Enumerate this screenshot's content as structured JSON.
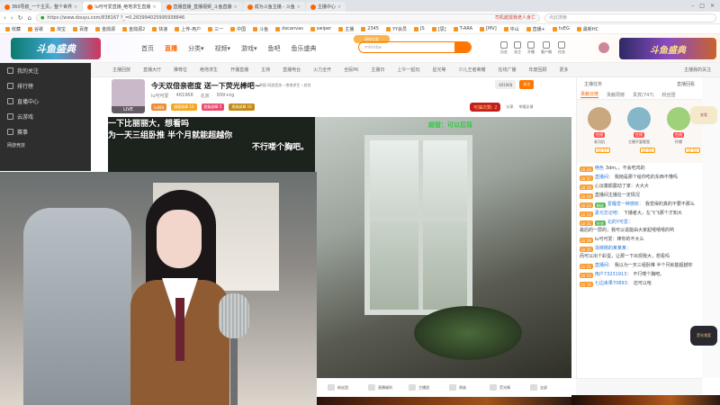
{
  "browser": {
    "tabs": [
      {
        "label": "360导航_一个主页，整个世界",
        "active": false
      },
      {
        "label": "lu可可爱直播_绝地求生直播",
        "active": true
      },
      {
        "label": "直播直播_直播视频_斗鱼直播",
        "active": false
      },
      {
        "label": "成为斗鱼主播 - 斗鱼",
        "active": false
      },
      {
        "label": "主播中心",
        "active": false
      }
    ],
    "url": "https://www.douyu.com/838167 ?_=0.263994025995938846",
    "url_hot": "司机越需我老人身亡",
    "search_placeholder": "点此搜索",
    "bookmarks": [
      "收藏",
      "谷歌",
      "淘宝",
      "百度",
      "金鼎源",
      "金鼎源2",
      "快速",
      "上传-用户",
      "三一",
      "中国",
      "斗鱼",
      "dxcanvas",
      "swiper",
      "主播",
      "2345",
      "YY会员",
      "JS",
      "[思]",
      "T-ARA",
      "[MV]",
      "中山",
      "直播+",
      "tvEG",
      "最新HC"
    ]
  },
  "header": {
    "logo_text": "斗鱼盛典",
    "nav": [
      {
        "label": "首页",
        "active": false
      },
      {
        "label": "直播",
        "active": true
      },
      {
        "label": "分类▾",
        "active": false
      },
      {
        "label": "视频▾",
        "active": false
      },
      {
        "label": "游戏▾",
        "active": false
      },
      {
        "label": "鱼吧",
        "active": false
      },
      {
        "label": "鱼乐盛典",
        "active": false
      }
    ],
    "promo_label": "接你出发",
    "search_placeholder": "mimiba",
    "icons": [
      {
        "name": "history",
        "label": "历史"
      },
      {
        "name": "follow",
        "label": "关注"
      },
      {
        "name": "live",
        "label": "开播"
      },
      {
        "name": "client",
        "label": "客户端"
      },
      {
        "name": "task",
        "label": "任务"
      }
    ],
    "banner_right": "斗鱼盛典"
  },
  "sidebar": {
    "items": [
      {
        "label": "我的关注"
      },
      {
        "label": "排行榜"
      },
      {
        "label": "直播中心"
      },
      {
        "label": "云游戏"
      },
      {
        "label": "赛事"
      }
    ],
    "small_item": "网游竞技"
  },
  "catbar": {
    "items": [
      "主播回放",
      "直播大厅",
      "推荐位",
      "绝地求生",
      "开播直播",
      "主持",
      "直播电台",
      "火力全开",
      "全民PK",
      "主播日",
      "上午一起玩",
      "星光等",
      "少儿王者荣耀",
      "在线广播",
      "年度回顾",
      "更多"
    ],
    "my_follow": "主播我的关注"
  },
  "room": {
    "title": "今天双倍亲密度 送一下荧光棒吧~",
    "title_meta": "举报  网游竞技 › 绝地求生 › 综合",
    "live_badge": "LIVE",
    "streamer": "lu可可爱",
    "room_id": "481968",
    "area": "北京",
    "followers": "999+kg",
    "tags": [
      {
        "label": "lv888",
        "color": "#f08d34"
      },
      {
        "label": "福星勋章 10",
        "color": "#f5a623"
      },
      {
        "label": "超级勋章 5",
        "color": "#e94b6f"
      },
      {
        "label": "贵族勋章 10",
        "color": "#c48b14"
      }
    ],
    "btn_id": "481968",
    "btn_follow": "关注",
    "hongbao": "可抽次数: 2",
    "share": "分享",
    "report": "举报反馈"
  },
  "video": {
    "subtitle_lines": [
      "一下比丽丽大，想看吗",
      "为一天三组卧推 半个月就能超越你",
      "不行喽个胸吧。"
    ],
    "chair_text": "超管：可以后背"
  },
  "player_toolbar": {
    "items": [
      "粉丝团",
      "直播福利",
      "主播团",
      "贵族",
      "荧光棒",
      "全部"
    ]
  },
  "chat": {
    "top_left": "主播任务",
    "top_right": "直播回看",
    "tabs": [
      {
        "label": "贡献日榜",
        "active": true
      },
      {
        "label": "贡献周榜",
        "active": false
      },
      {
        "label": "贵宾(747)",
        "active": false
      },
      {
        "label": "粉丝团",
        "active": false
      }
    ],
    "top_gifts": [
      {
        "name": "老司机",
        "badge": "在线",
        "color": "#c9a77f"
      },
      {
        "name": "主播不要瞪我",
        "badge": "在线",
        "color": "#86b7c9"
      },
      {
        "name": "柠檬",
        "badge": "在线",
        "color": "#9fd07a"
      }
    ],
    "gift_levels": [
      "LV 57",
      "LV 55",
      "LV 52"
    ],
    "messages": [
      {
        "lv": "LV 24",
        "fan": "",
        "nick": "绝色",
        "text": "3dm。。不会吃鸡的"
      },
      {
        "lv": "LV 37",
        "fan": "",
        "nick": "直播间：",
        "text": "我她是那个给你吃的东西不懂吗"
      },
      {
        "lv": "LV 16",
        "fan": "",
        "nick": "",
        "text": "心淡童颜震动了家：大大大"
      },
      {
        "lv": "LV 29",
        "fan": "",
        "nick": "",
        "text": "直播间主播在一定情况"
      },
      {
        "lv": "LV 22",
        "fan": "粉丝",
        "nick": "爱睡觉一种感叹：",
        "text": "我觉得的真的不要不那么"
      },
      {
        "lv": "LV 13",
        "fan": "",
        "nick": "素元忘记吧：",
        "text": "下播者大，左飞飞那个才知大"
      },
      {
        "lv": "LV 31",
        "fan": "社会",
        "nick": "北的Y可爱：",
        "text": "最后的一层的，我可以说能由大家起嘻嘻嘻的哟"
      },
      {
        "lv": "LV 29",
        "fan": "",
        "nick": "",
        "text": "lu可可爱：棒你的不大么"
      },
      {
        "lv": "LV 35",
        "fan": "",
        "nick": "泳锵锵的某某某：",
        "text": "而可以出个彩蛋，让那一下出现我大，想看吗"
      },
      {
        "lv": "LV 21",
        "fan": "",
        "nick": "直播间：",
        "text": "我以为一天三组卧推 半个月就能超越你"
      },
      {
        "lv": "LV 15",
        "fan": "",
        "nick": "用户73231913：",
        "text": "不行喽个胸吧。"
      },
      {
        "lv": "LV 16",
        "fan": "",
        "nick": "七边来果70893：",
        "text": "还可以哈"
      }
    ],
    "float_top": "查看",
    "float_bottom": "荧光领奖"
  },
  "colors": {
    "accent": "#ff7700",
    "sidebar_bg": "#2e2e2e"
  }
}
